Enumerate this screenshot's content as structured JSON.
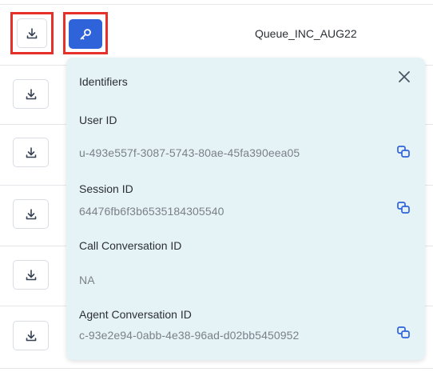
{
  "table": {
    "queue_name": "Queue_INC_AUG22"
  },
  "icons": {
    "download": "download-icon",
    "key": "key-icon",
    "close": "close-icon",
    "copy": "copy-icon"
  },
  "colors": {
    "primary": "#2f63d9",
    "highlight": "#e5312a",
    "popover_bg": "#e5f3f6",
    "muted_text": "#7a808a"
  },
  "popover": {
    "title": "Identifiers",
    "user_id_label": "User ID",
    "user_id_value": "u-493e557f-3087-5743-80ae-45fa390eea05",
    "session_id_label": "Session ID",
    "session_id_value": "64476fb6f3b6535184305540",
    "call_conversation_id_label": "Call Conversation ID",
    "call_conversation_id_value": "NA",
    "agent_conversation_id_label": "Agent Conversation ID",
    "agent_conversation_id_value": "c-93e2e94-0abb-4e38-96ad-d02bb5450952"
  }
}
